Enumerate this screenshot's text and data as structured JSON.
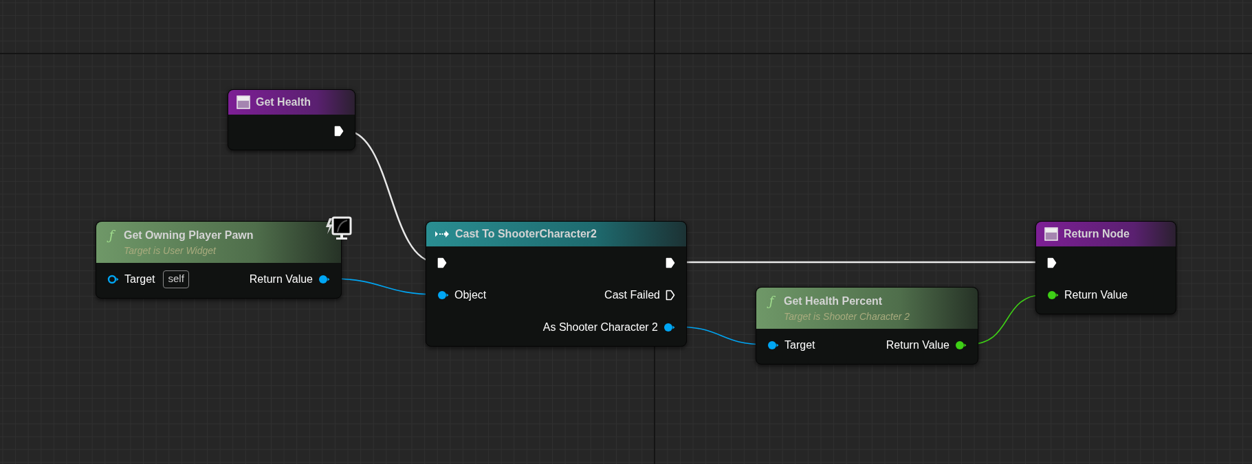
{
  "nodes": [
    {
      "kind": "pure",
      "title": "Get Health",
      "outputs": [
        {
          "kind": "exec",
          "connected": true
        }
      ]
    },
    {
      "kind": "function",
      "glyph": "ƒ",
      "title": "Get Owning Player Pawn",
      "subtitle": "Target is User Widget",
      "widget_badge": true,
      "inputs": [
        {
          "kind": "object",
          "label": "Target",
          "value": "self",
          "connected": false
        }
      ],
      "outputs": [
        {
          "kind": "object",
          "label": "Return Value",
          "connected": true
        }
      ]
    },
    {
      "kind": "cast",
      "title": "Cast To ShooterCharacter2",
      "inputs": [
        {
          "kind": "exec",
          "connected": true
        },
        {
          "kind": "object",
          "label": "Object",
          "connected": true
        }
      ],
      "outputs": [
        {
          "kind": "exec",
          "connected": true
        },
        {
          "kind": "exec",
          "label": "Cast Failed",
          "connected": false
        },
        {
          "kind": "object",
          "label": "As Shooter Character 2",
          "connected": true
        }
      ]
    },
    {
      "kind": "function",
      "glyph": "ƒ",
      "title": "Get Health Percent",
      "subtitle": "Target is Shooter Character 2",
      "inputs": [
        {
          "kind": "object",
          "label": "Target",
          "connected": true
        }
      ],
      "outputs": [
        {
          "kind": "float",
          "label": "Return Value",
          "connected": true
        }
      ]
    },
    {
      "kind": "pure",
      "title": "Return Node",
      "inputs": [
        {
          "kind": "exec",
          "connected": true
        },
        {
          "kind": "float",
          "label": "Return Value",
          "connected": true
        }
      ]
    }
  ]
}
